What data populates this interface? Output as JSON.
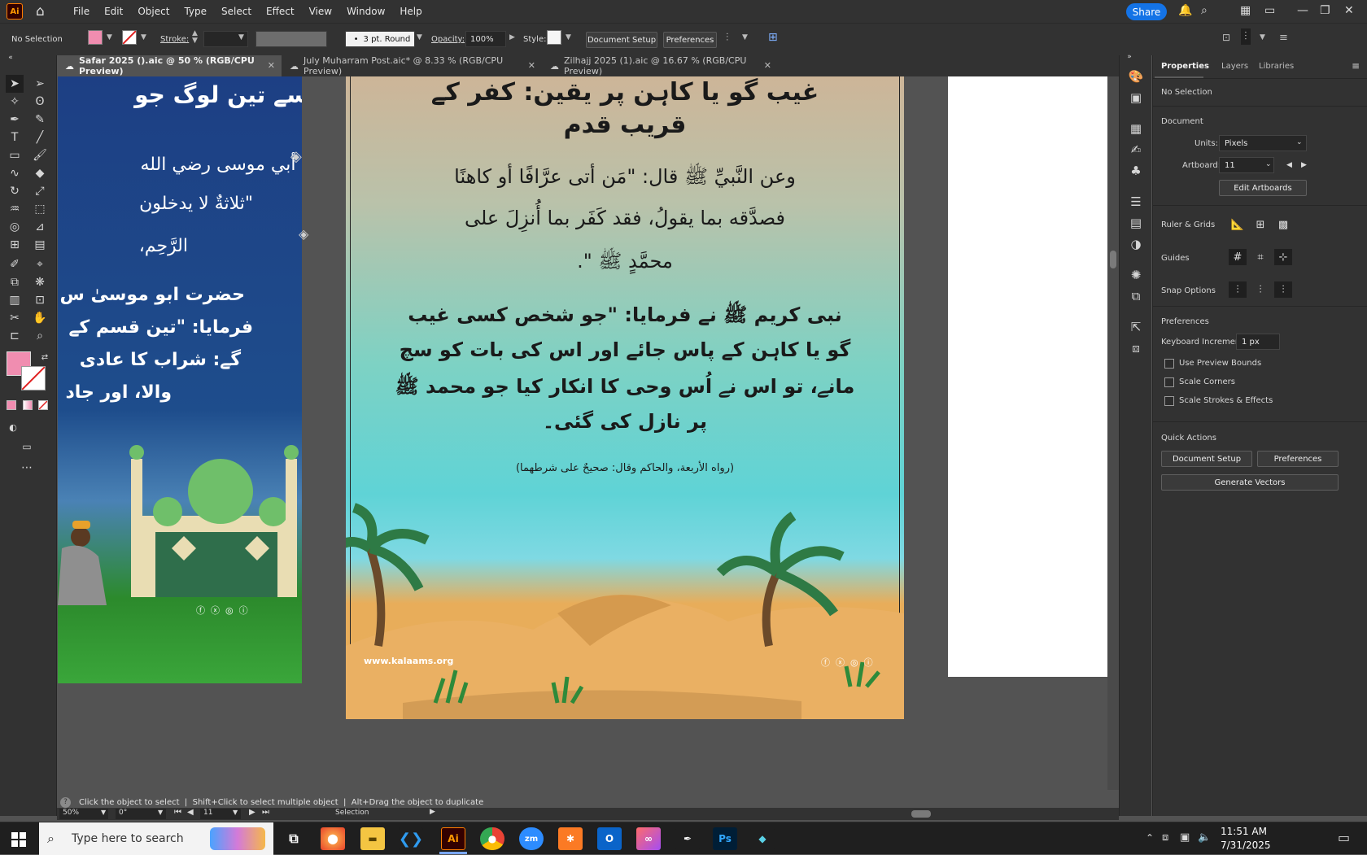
{
  "app": {
    "logo": "Ai",
    "name": "Adobe Illustrator"
  },
  "menu": [
    "File",
    "Edit",
    "Object",
    "Type",
    "Select",
    "Effect",
    "View",
    "Window",
    "Help"
  ],
  "share_label": "Share",
  "control": {
    "selection": "No Selection",
    "stroke_label": "Stroke:",
    "brush": "3 pt. Round",
    "opacity_label": "Opacity:",
    "opacity_value": "100%",
    "style_label": "Style:",
    "doc_setup": "Document Setup",
    "preferences": "Preferences",
    "fill_color": "#f08db0"
  },
  "tabs": [
    {
      "label": "Safar 2025 ().aic @ 50 % (RGB/CPU Preview)",
      "active": true
    },
    {
      "label": "July Muharram Post.aic* @ 8.33 % (RGB/CPU Preview)",
      "active": false
    },
    {
      "label": "Zilhajj 2025 (1).aic @ 16.67 % (RGB/CPU Preview)",
      "active": false
    }
  ],
  "art_left": {
    "line1": "ایسے تین لوگ جو",
    "line2": "وعن أبي موسى رضي الله",
    "line3": "\"ثلاثةٌ لا يدخلون",
    "line4": "الرَّحِم،",
    "line5": "حضرت ابو موسیٰ س",
    "line6": "فرمایا: \"تین قسم کے",
    "line7": "گے: شراب کا عادی",
    "line8": "والا، اور جاد"
  },
  "art_center": {
    "title1": "غیب گو یا کاہن پر یقین: کفر کے",
    "title2": "قریب قدم",
    "arabic1": "وعن النَّبيِّ ﷺ قال: \"مَن أتى عرَّافًا أو كاهنًا",
    "arabic2": "فصدَّقه بما يقولُ، فقد كَفَر بما أُنزِلَ على",
    "arabic3": "محمَّدٍ ﷺ \".",
    "urdu1": "نبی کریم ﷺ نے فرمایا: \"جو شخص کسی غیب",
    "urdu2": "گو یا کاہن کے پاس جائے اور اس کی بات کو سچ",
    "urdu3": "مانے، تو اس نے اُس وحی کا انکار کیا جو محمد ﷺ",
    "urdu4": "پر نازل کی گئی۔",
    "source": "(رواه الأربعة، والحاكم وقال: صحيحٌ على شرطهما)",
    "website": "www.kalaams.org"
  },
  "panel": {
    "tabs": [
      "Properties",
      "Layers",
      "Libraries"
    ],
    "selection": "No Selection",
    "document": "Document",
    "units_label": "Units:",
    "units_value": "Pixels",
    "artboard_label": "Artboard:",
    "artboard_value": "11",
    "edit_artboards": "Edit Artboards",
    "ruler_grids": "Ruler & Grids",
    "guides": "Guides",
    "snap_options": "Snap Options",
    "preferences": "Preferences",
    "keyboard_increment_label": "Keyboard Increment:",
    "keyboard_increment_value": "1 px",
    "use_preview_bounds": "Use Preview Bounds",
    "scale_corners": "Scale Corners",
    "scale_strokes": "Scale Strokes & Effects",
    "quick_actions": "Quick Actions",
    "doc_setup": "Document Setup",
    "prefs_button": "Preferences",
    "generate_vectors": "Generate Vectors"
  },
  "hint": "Click the object to select  |  Shift+Click to select multiple object  |  Alt+Drag the object to duplicate",
  "status": {
    "zoom": "50%",
    "rotation": "0°",
    "artboard": "11",
    "tool": "Selection"
  },
  "taskbar": {
    "search_placeholder": "Type here to search",
    "time": "11:51 AM",
    "date": "7/31/2025"
  }
}
